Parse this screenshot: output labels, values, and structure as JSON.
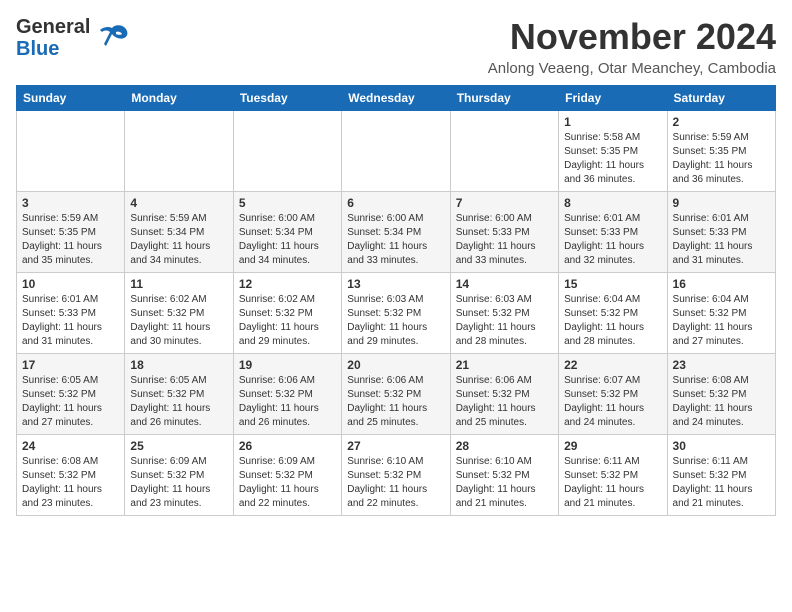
{
  "header": {
    "logo_line1": "General",
    "logo_line2": "Blue",
    "month_title": "November 2024",
    "subtitle": "Anlong Veaeng, Otar Meanchey, Cambodia"
  },
  "days_of_week": [
    "Sunday",
    "Monday",
    "Tuesday",
    "Wednesday",
    "Thursday",
    "Friday",
    "Saturday"
  ],
  "weeks": [
    [
      {
        "day": "",
        "info": ""
      },
      {
        "day": "",
        "info": ""
      },
      {
        "day": "",
        "info": ""
      },
      {
        "day": "",
        "info": ""
      },
      {
        "day": "",
        "info": ""
      },
      {
        "day": "1",
        "info": "Sunrise: 5:58 AM\nSunset: 5:35 PM\nDaylight: 11 hours\nand 36 minutes."
      },
      {
        "day": "2",
        "info": "Sunrise: 5:59 AM\nSunset: 5:35 PM\nDaylight: 11 hours\nand 36 minutes."
      }
    ],
    [
      {
        "day": "3",
        "info": "Sunrise: 5:59 AM\nSunset: 5:35 PM\nDaylight: 11 hours\nand 35 minutes."
      },
      {
        "day": "4",
        "info": "Sunrise: 5:59 AM\nSunset: 5:34 PM\nDaylight: 11 hours\nand 34 minutes."
      },
      {
        "day": "5",
        "info": "Sunrise: 6:00 AM\nSunset: 5:34 PM\nDaylight: 11 hours\nand 34 minutes."
      },
      {
        "day": "6",
        "info": "Sunrise: 6:00 AM\nSunset: 5:34 PM\nDaylight: 11 hours\nand 33 minutes."
      },
      {
        "day": "7",
        "info": "Sunrise: 6:00 AM\nSunset: 5:33 PM\nDaylight: 11 hours\nand 33 minutes."
      },
      {
        "day": "8",
        "info": "Sunrise: 6:01 AM\nSunset: 5:33 PM\nDaylight: 11 hours\nand 32 minutes."
      },
      {
        "day": "9",
        "info": "Sunrise: 6:01 AM\nSunset: 5:33 PM\nDaylight: 11 hours\nand 31 minutes."
      }
    ],
    [
      {
        "day": "10",
        "info": "Sunrise: 6:01 AM\nSunset: 5:33 PM\nDaylight: 11 hours\nand 31 minutes."
      },
      {
        "day": "11",
        "info": "Sunrise: 6:02 AM\nSunset: 5:32 PM\nDaylight: 11 hours\nand 30 minutes."
      },
      {
        "day": "12",
        "info": "Sunrise: 6:02 AM\nSunset: 5:32 PM\nDaylight: 11 hours\nand 29 minutes."
      },
      {
        "day": "13",
        "info": "Sunrise: 6:03 AM\nSunset: 5:32 PM\nDaylight: 11 hours\nand 29 minutes."
      },
      {
        "day": "14",
        "info": "Sunrise: 6:03 AM\nSunset: 5:32 PM\nDaylight: 11 hours\nand 28 minutes."
      },
      {
        "day": "15",
        "info": "Sunrise: 6:04 AM\nSunset: 5:32 PM\nDaylight: 11 hours\nand 28 minutes."
      },
      {
        "day": "16",
        "info": "Sunrise: 6:04 AM\nSunset: 5:32 PM\nDaylight: 11 hours\nand 27 minutes."
      }
    ],
    [
      {
        "day": "17",
        "info": "Sunrise: 6:05 AM\nSunset: 5:32 PM\nDaylight: 11 hours\nand 27 minutes."
      },
      {
        "day": "18",
        "info": "Sunrise: 6:05 AM\nSunset: 5:32 PM\nDaylight: 11 hours\nand 26 minutes."
      },
      {
        "day": "19",
        "info": "Sunrise: 6:06 AM\nSunset: 5:32 PM\nDaylight: 11 hours\nand 26 minutes."
      },
      {
        "day": "20",
        "info": "Sunrise: 6:06 AM\nSunset: 5:32 PM\nDaylight: 11 hours\nand 25 minutes."
      },
      {
        "day": "21",
        "info": "Sunrise: 6:06 AM\nSunset: 5:32 PM\nDaylight: 11 hours\nand 25 minutes."
      },
      {
        "day": "22",
        "info": "Sunrise: 6:07 AM\nSunset: 5:32 PM\nDaylight: 11 hours\nand 24 minutes."
      },
      {
        "day": "23",
        "info": "Sunrise: 6:08 AM\nSunset: 5:32 PM\nDaylight: 11 hours\nand 24 minutes."
      }
    ],
    [
      {
        "day": "24",
        "info": "Sunrise: 6:08 AM\nSunset: 5:32 PM\nDaylight: 11 hours\nand 23 minutes."
      },
      {
        "day": "25",
        "info": "Sunrise: 6:09 AM\nSunset: 5:32 PM\nDaylight: 11 hours\nand 23 minutes."
      },
      {
        "day": "26",
        "info": "Sunrise: 6:09 AM\nSunset: 5:32 PM\nDaylight: 11 hours\nand 22 minutes."
      },
      {
        "day": "27",
        "info": "Sunrise: 6:10 AM\nSunset: 5:32 PM\nDaylight: 11 hours\nand 22 minutes."
      },
      {
        "day": "28",
        "info": "Sunrise: 6:10 AM\nSunset: 5:32 PM\nDaylight: 11 hours\nand 21 minutes."
      },
      {
        "day": "29",
        "info": "Sunrise: 6:11 AM\nSunset: 5:32 PM\nDaylight: 11 hours\nand 21 minutes."
      },
      {
        "day": "30",
        "info": "Sunrise: 6:11 AM\nSunset: 5:32 PM\nDaylight: 11 hours\nand 21 minutes."
      }
    ]
  ]
}
